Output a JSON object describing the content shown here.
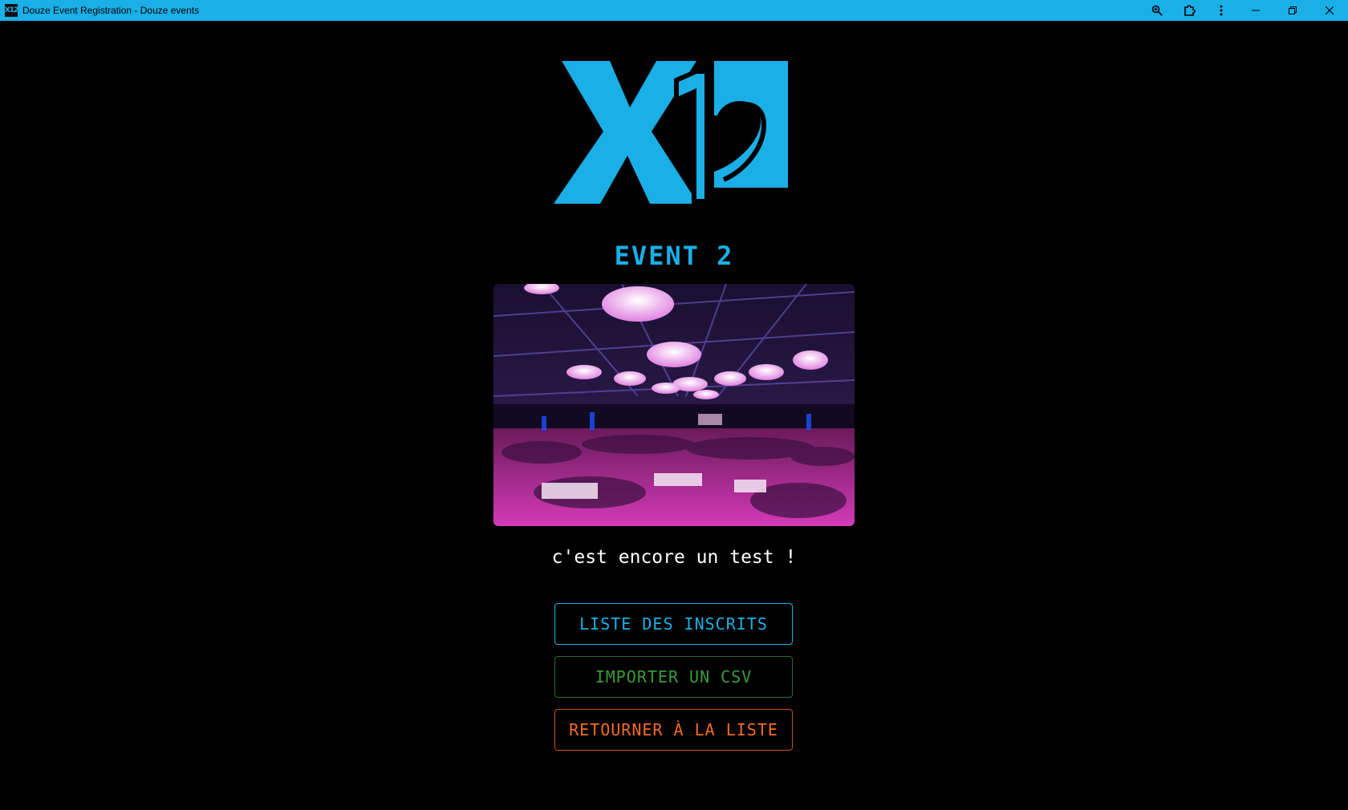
{
  "window": {
    "app_icon_text": "X12",
    "title": "Douze Event Registration - Douze events",
    "controls": [
      "zoom-icon",
      "extensions-icon",
      "more-menu-icon",
      "minimize-icon",
      "restore-icon",
      "close-icon"
    ]
  },
  "logo": {
    "text": "X12",
    "color": "#1aafe6"
  },
  "event": {
    "title": "EVENT 2",
    "description": "c'est encore un test !"
  },
  "actions": {
    "list_label": "LISTE DES INSCRITS",
    "import_label": "IMPORTER UN CSV",
    "back_label": "RETOURNER À LA LISTE"
  },
  "colors": {
    "accent": "#1aafe6",
    "import": "#3a9b3a",
    "back": "#f26d21",
    "background": "#000000"
  }
}
